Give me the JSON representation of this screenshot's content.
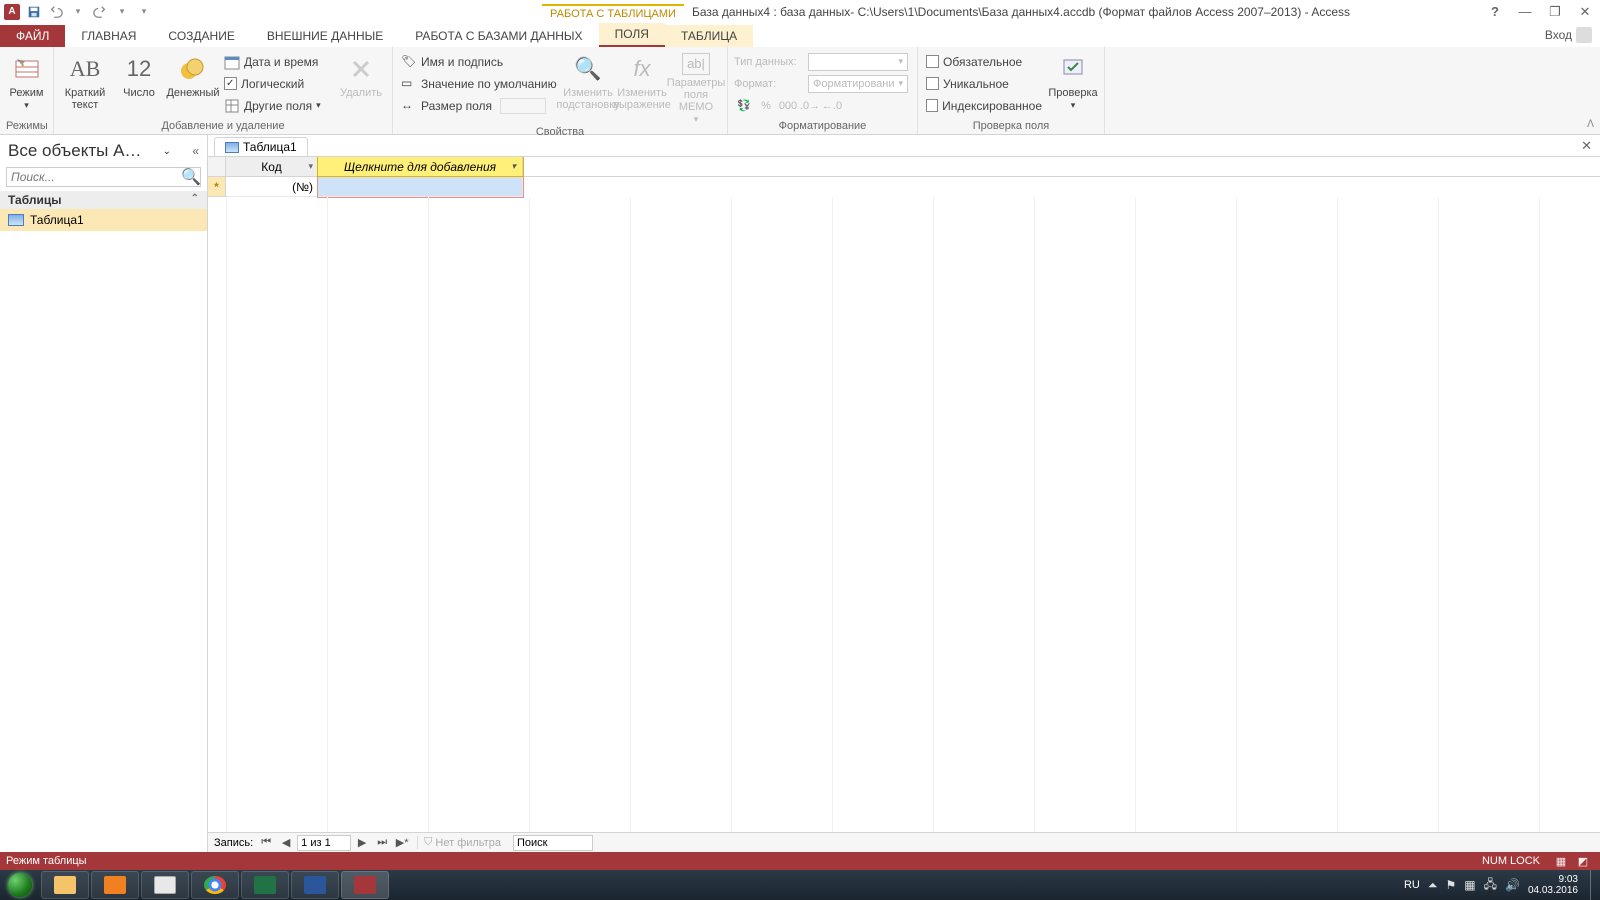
{
  "titlebar": {
    "context_title": "РАБОТА С ТАБЛИЦАМИ",
    "doc_title": "База данных4 : база данных- C:\\Users\\1\\Documents\\База данных4.accdb (Формат файлов Access 2007–2013) - Access"
  },
  "tabs": {
    "file": "ФАЙЛ",
    "home": "ГЛАВНАЯ",
    "create": "СОЗДАНИЕ",
    "external": "ВНЕШНИЕ ДАННЫЕ",
    "dbtools": "РАБОТА С БАЗАМИ ДАННЫХ",
    "fields": "ПОЛЯ",
    "table": "ТАБЛИЦА",
    "login": "Вход"
  },
  "ribbon": {
    "modes": {
      "view": "Режим",
      "group": "Режимы"
    },
    "addrem": {
      "short_text": "Краткий текст",
      "number": "Число",
      "currency": "Денежный",
      "datetime": "Дата и время",
      "yesno": "Логический",
      "more": "Другие поля",
      "delete": "Удалить",
      "group": "Добавление и удаление"
    },
    "props": {
      "name_caption": "Имя и подпись",
      "default_value": "Значение по умолчанию",
      "field_size": "Размер поля",
      "lookup": "Изменить подстановку",
      "expression": "Изменить выражение",
      "memo": "Параметры поля MEMO",
      "group": "Свойства"
    },
    "formatting": {
      "datatype_label": "Тип данных:",
      "format_label": "Формат:",
      "format_value": "Форматировани",
      "group": "Форматирование"
    },
    "validation": {
      "required": "Обязательное",
      "unique": "Уникальное",
      "indexed": "Индексированное",
      "validate": "Проверка",
      "group": "Проверка поля"
    }
  },
  "nav": {
    "header": "Все объекты A…",
    "search_placeholder": "Поиск...",
    "category": "Таблицы",
    "item1": "Таблица1"
  },
  "doc": {
    "tab": "Таблица1",
    "col_id": "Код",
    "col_add": "Щелкните для добавления",
    "new_id": "(№)"
  },
  "recnav": {
    "label": "Запись:",
    "pos": "1 из 1",
    "filter": "Нет фильтра",
    "search": "Поиск"
  },
  "status": {
    "mode": "Режим таблицы",
    "numlock": "NUM LOCK"
  },
  "tray": {
    "lang": "RU",
    "time": "9:03",
    "date": "04.03.2016"
  }
}
